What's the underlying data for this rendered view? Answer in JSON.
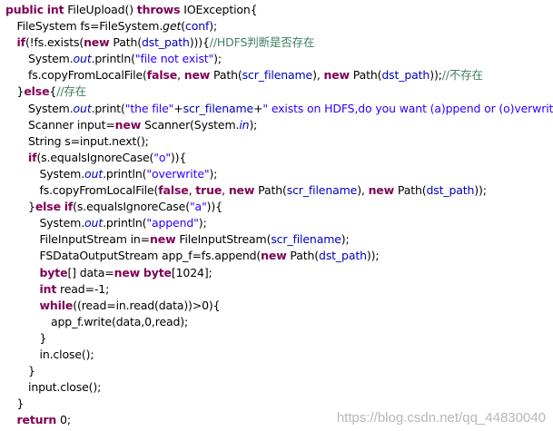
{
  "code": {
    "lines": [
      {
        "indent": 0,
        "tokens": [
          [
            "kw",
            "public"
          ],
          [
            "pl",
            " "
          ],
          [
            "kw",
            "int"
          ],
          [
            "pl",
            " FileUpload() "
          ],
          [
            "kw",
            "throws"
          ],
          [
            "pl",
            " IOException{"
          ]
        ]
      },
      {
        "indent": 1,
        "tokens": [
          [
            "pl",
            "FileSystem fs=FileSystem."
          ],
          [
            "it",
            "get"
          ],
          [
            "pl",
            "("
          ],
          [
            "fld",
            "conf"
          ],
          [
            "pl",
            ");"
          ]
        ]
      },
      {
        "indent": 1,
        "tokens": [
          [
            "kw",
            "if"
          ],
          [
            "pl",
            "(!fs.exists("
          ],
          [
            "kw",
            "new"
          ],
          [
            "pl",
            " Path("
          ],
          [
            "fld",
            "dst_path"
          ],
          [
            "pl",
            ")))"
          ],
          [
            "pl",
            "{"
          ],
          [
            "cmt",
            "//HDFS判断是否存在"
          ]
        ]
      },
      {
        "indent": 2,
        "tokens": [
          [
            "pl",
            "System."
          ],
          [
            "sfld",
            "out"
          ],
          [
            "pl",
            ".println("
          ],
          [
            "str",
            "\"file not exist\""
          ],
          [
            "pl",
            ");"
          ]
        ]
      },
      {
        "indent": 2,
        "tokens": [
          [
            "pl",
            "fs.copyFromLocalFile("
          ],
          [
            "kw",
            "false"
          ],
          [
            "pl",
            ", "
          ],
          [
            "kw",
            "new"
          ],
          [
            "pl",
            " Path("
          ],
          [
            "fld",
            "scr_filename"
          ],
          [
            "pl",
            "), "
          ],
          [
            "kw",
            "new"
          ],
          [
            "pl",
            " Path("
          ],
          [
            "fld",
            "dst_path"
          ],
          [
            "pl",
            "));"
          ],
          [
            "cmt",
            "//不存在"
          ]
        ]
      },
      {
        "indent": 1,
        "tokens": [
          [
            "pl",
            "}"
          ],
          [
            "kw",
            "else"
          ],
          [
            "pl",
            "{"
          ],
          [
            "cmt",
            "//存在"
          ]
        ]
      },
      {
        "indent": 2,
        "tokens": [
          [
            "pl",
            "System."
          ],
          [
            "sfld",
            "out"
          ],
          [
            "pl",
            ".print("
          ],
          [
            "str",
            "\"the file\""
          ],
          [
            "pl",
            "+"
          ],
          [
            "fld",
            "scr_filename"
          ],
          [
            "pl",
            "+"
          ],
          [
            "str",
            "\" exists on HDFS,do you want (a)ppend or (o)verwrite?\""
          ],
          [
            "pl",
            ");"
          ]
        ]
      },
      {
        "indent": 2,
        "tokens": [
          [
            "pl",
            "Scanner input="
          ],
          [
            "kw",
            "new"
          ],
          [
            "pl",
            " Scanner(System."
          ],
          [
            "sfld",
            "in"
          ],
          [
            "pl",
            ");"
          ]
        ]
      },
      {
        "indent": 2,
        "tokens": [
          [
            "pl",
            "String s=input.next();"
          ]
        ]
      },
      {
        "indent": 2,
        "tokens": [
          [
            "kw",
            "if"
          ],
          [
            "pl",
            "(s.equalsIgnoreCase("
          ],
          [
            "str",
            "\"o\""
          ],
          [
            "pl",
            "))"
          ],
          [
            "pl",
            "{"
          ]
        ]
      },
      {
        "indent": 3,
        "tokens": [
          [
            "pl",
            "System."
          ],
          [
            "sfld",
            "out"
          ],
          [
            "pl",
            ".println("
          ],
          [
            "str",
            "\"overwrite\""
          ],
          [
            "pl",
            ");"
          ]
        ]
      },
      {
        "indent": 3,
        "tokens": [
          [
            "pl",
            "fs.copyFromLocalFile("
          ],
          [
            "kw",
            "false"
          ],
          [
            "pl",
            ", "
          ],
          [
            "kw",
            "true"
          ],
          [
            "pl",
            ", "
          ],
          [
            "kw",
            "new"
          ],
          [
            "pl",
            " Path("
          ],
          [
            "fld",
            "scr_filename"
          ],
          [
            "pl",
            "), "
          ],
          [
            "kw",
            "new"
          ],
          [
            "pl",
            " Path("
          ],
          [
            "fld",
            "dst_path"
          ],
          [
            "pl",
            "));"
          ]
        ]
      },
      {
        "indent": 2,
        "tokens": [
          [
            "pl",
            "}"
          ],
          [
            "kw",
            "else"
          ],
          [
            "pl",
            " "
          ],
          [
            "kw",
            "if"
          ],
          [
            "pl",
            "(s.equalsIgnoreCase("
          ],
          [
            "str",
            "\"a\""
          ],
          [
            "pl",
            "))"
          ],
          [
            "pl",
            "{"
          ]
        ]
      },
      {
        "indent": 3,
        "tokens": [
          [
            "pl",
            "System."
          ],
          [
            "sfld",
            "out"
          ],
          [
            "pl",
            ".println("
          ],
          [
            "str",
            "\"append\""
          ],
          [
            "pl",
            ");"
          ]
        ]
      },
      {
        "indent": 3,
        "tokens": [
          [
            "pl",
            "FileInputStream in="
          ],
          [
            "kw",
            "new"
          ],
          [
            "pl",
            " FileInputStream("
          ],
          [
            "fld",
            "scr_filename"
          ],
          [
            "pl",
            ");"
          ]
        ]
      },
      {
        "indent": 3,
        "tokens": [
          [
            "pl",
            "FSDataOutputStream app_f=fs.append("
          ],
          [
            "kw",
            "new"
          ],
          [
            "pl",
            " Path("
          ],
          [
            "fld",
            "dst_path"
          ],
          [
            "pl",
            "));"
          ]
        ]
      },
      {
        "indent": 3,
        "tokens": [
          [
            "kw",
            "byte"
          ],
          [
            "pl",
            "[] data="
          ],
          [
            "kw",
            "new"
          ],
          [
            "pl",
            " "
          ],
          [
            "kw",
            "byte"
          ],
          [
            "pl",
            "[1024];"
          ]
        ]
      },
      {
        "indent": 3,
        "tokens": [
          [
            "kw",
            "int"
          ],
          [
            "pl",
            " read=-1;"
          ]
        ]
      },
      {
        "indent": 3,
        "tokens": [
          [
            "kw",
            "while"
          ],
          [
            "pl",
            "((read=in.read(data))>0){"
          ]
        ]
      },
      {
        "indent": 4,
        "tokens": [
          [
            "pl",
            "app_f.write(data,0,read);"
          ]
        ]
      },
      {
        "indent": 3,
        "tokens": [
          [
            "pl",
            "}"
          ]
        ]
      },
      {
        "indent": 3,
        "tokens": [
          [
            "pl",
            "in.close();"
          ]
        ]
      },
      {
        "indent": 2,
        "tokens": [
          [
            "pl",
            "}"
          ]
        ]
      },
      {
        "indent": 2,
        "tokens": [
          [
            "pl",
            "input.close();"
          ]
        ]
      },
      {
        "indent": 1,
        "tokens": [
          [
            "pl",
            "}"
          ]
        ]
      },
      {
        "indent": 1,
        "tokens": [
          [
            "kw",
            "return"
          ],
          [
            "pl",
            " 0;"
          ]
        ]
      }
    ]
  },
  "watermark": {
    "text": "https://blog.csdn.net/qq_44830040"
  },
  "colors": {
    "keyword": "#7f0055",
    "string": "#2a00ff",
    "field": "#0000c0",
    "comment": "#3f7f5f",
    "text": "#000000",
    "background": "#ffffff"
  }
}
